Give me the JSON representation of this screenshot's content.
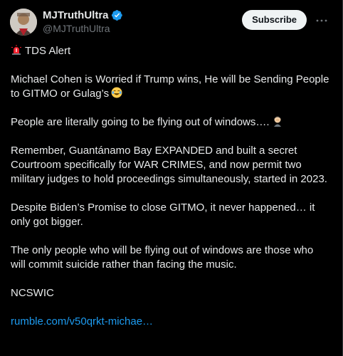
{
  "author": {
    "display_name": "MJTruthUltra",
    "handle": "@MJTruthUltra",
    "verified_color": "#1d9bf0"
  },
  "actions": {
    "subscribe_label": "Subscribe",
    "more_icon": "ellipsis-icon"
  },
  "post": {
    "title": "TDS Alert",
    "p1_line": "Michael Cohen is Worried if Trump wins, He will be Sending People to GITMO or Gulag’s",
    "p2_line": "People are literally going to be flying out of windows….",
    "p3": "Remember, Guantánamo Bay EXPANDED and built a secret Courtroom specifically for WAR CRIMES, and now permit two military judges to hold proceedings simultaneously, started in 2023.",
    "p4": "Despite Biden’s Promise to close GITMO, it never happened… it only got bigger.",
    "p5": "The only people who will be flying out of windows are those who will commit suicide rather than facing the music.",
    "p6": "NCSWIC",
    "link_text": "rumble.com/v50qrkt-michae…"
  },
  "colors": {
    "background": "#000000",
    "text": "#e7e9ea",
    "muted": "#71767b",
    "link": "#1d9bf0",
    "alert": "#f4212e"
  }
}
